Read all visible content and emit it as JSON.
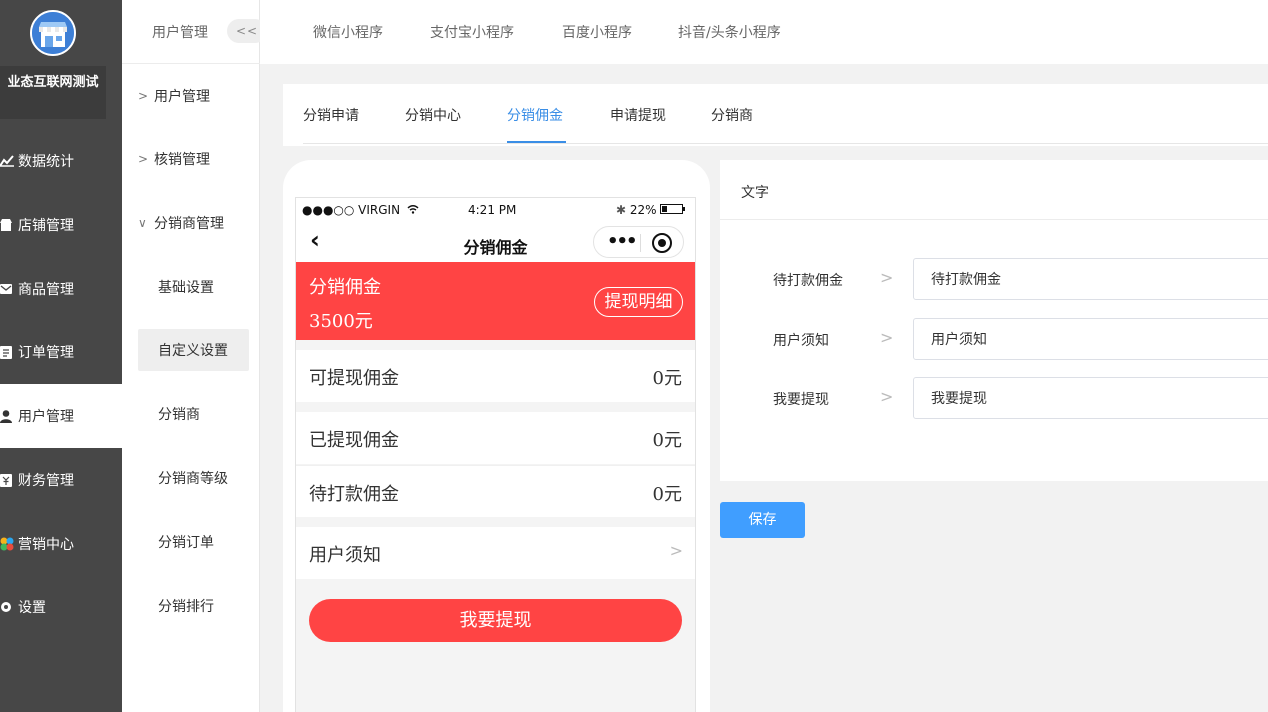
{
  "sidebar": {
    "shop_name": "业态互联网测试",
    "items": [
      {
        "label": "数据统计",
        "icon": "chart-line-icon"
      },
      {
        "label": "店铺管理",
        "icon": "store-icon"
      },
      {
        "label": "商品管理",
        "icon": "goods-icon"
      },
      {
        "label": "订单管理",
        "icon": "order-icon"
      },
      {
        "label": "用户管理",
        "icon": "user-icon",
        "active": true
      },
      {
        "label": "财务管理",
        "icon": "finance-icon"
      },
      {
        "label": "营销中心",
        "icon": "marketing-icon"
      },
      {
        "label": "设置",
        "icon": "settings-icon"
      }
    ]
  },
  "subnav": {
    "title": "用户管理",
    "collapse": "<<",
    "groups": [
      {
        "label": "用户管理"
      },
      {
        "label": "核销管理"
      },
      {
        "label": "分销商管理"
      }
    ],
    "children": [
      {
        "label": "基础设置"
      },
      {
        "label": "自定义设置",
        "active": true
      },
      {
        "label": "分销商"
      },
      {
        "label": "分销商等级"
      },
      {
        "label": "分销订单"
      },
      {
        "label": "分销排行"
      }
    ]
  },
  "topbar": {
    "tabs": [
      "微信小程序",
      "支付宝小程序",
      "百度小程序",
      "抖音/头条小程序"
    ]
  },
  "content_tabs": {
    "tabs": [
      "分销申请",
      "分销中心",
      "分销佣金",
      "申请提现",
      "分销商"
    ],
    "active": "分销佣金"
  },
  "phone": {
    "status_left": "●●●○○ VIRGIN",
    "status_time": "4:21 PM",
    "status_battery": "22%",
    "nav_back": "‹",
    "nav_title": "分销佣金",
    "banner_label": "分销佣金",
    "banner_amount": "3500元",
    "banner_button": "提现明细",
    "rows": [
      {
        "label": "可提现佣金",
        "value": "0元"
      },
      {
        "label": "已提现佣金",
        "value": "0元"
      },
      {
        "label": "待打款佣金",
        "value": "0元"
      },
      {
        "label": "用户须知"
      }
    ],
    "withdraw_button": "我要提现"
  },
  "panel": {
    "title": "文字",
    "fields": [
      {
        "label": "待打款佣金",
        "value": "待打款佣金"
      },
      {
        "label": "用户须知",
        "value": "用户须知"
      },
      {
        "label": "我要提现",
        "value": "我要提现"
      }
    ],
    "save_label": "保存"
  },
  "colors": {
    "sidebar_bg": "#474747",
    "accent_blue": "#409eff",
    "tab_active": "#3a8ee6",
    "banner_red": "#ff4444"
  }
}
